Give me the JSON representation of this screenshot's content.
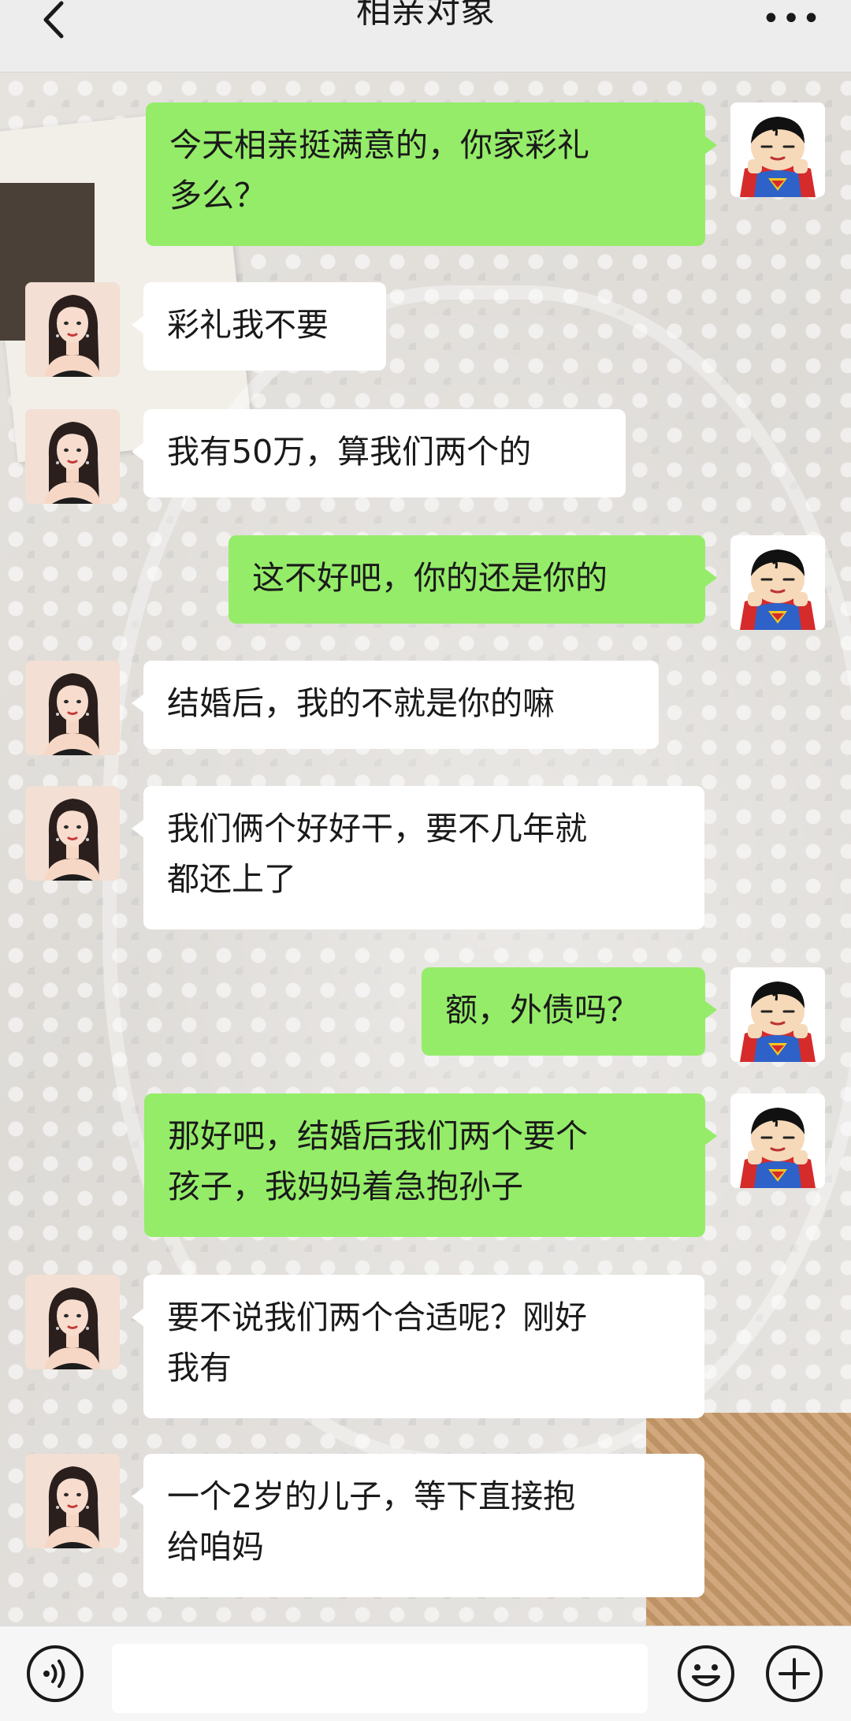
{
  "header": {
    "title": "相亲对象",
    "back_icon": "chevron-left-icon",
    "more_icon": "more-horizontal-icon",
    "more_glyph": "•••"
  },
  "messages": [
    {
      "sender": "me",
      "lines": [
        "今天相亲挺满意的，你家彩礼",
        "多么？"
      ]
    },
    {
      "sender": "contact",
      "lines": [
        "彩礼我不要"
      ]
    },
    {
      "sender": "contact",
      "lines": [
        "我有50万，算我们两个的"
      ]
    },
    {
      "sender": "me",
      "lines": [
        "这不好吧，你的还是你的"
      ]
    },
    {
      "sender": "contact",
      "lines": [
        "结婚后，我的不就是你的嘛"
      ]
    },
    {
      "sender": "contact",
      "lines": [
        "我们俩个好好干，要不几年就",
        "都还上了"
      ]
    },
    {
      "sender": "me",
      "lines": [
        "额，外债吗？"
      ]
    },
    {
      "sender": "me",
      "lines": [
        "那好吧，结婚后我们两个要个",
        "孩子，我妈妈着急抱孙子"
      ]
    },
    {
      "sender": "contact",
      "lines": [
        "要不说我们两个合适呢？刚好",
        "我有"
      ]
    },
    {
      "sender": "contact",
      "lines": [
        "一个2岁的儿子，等下直接抱",
        "给咱妈"
      ]
    }
  ],
  "colors": {
    "outgoing_bubble": "#95ec69",
    "incoming_bubble": "#ffffff",
    "header_bg": "#ededed"
  },
  "avatars": {
    "me": "superman-cartoon-avatar",
    "contact": "woman-portrait-avatar"
  },
  "input_bar": {
    "value": "",
    "voice_icon": "voice-icon",
    "emoji_icon": "emoji-icon",
    "plus_icon": "plus-icon"
  }
}
